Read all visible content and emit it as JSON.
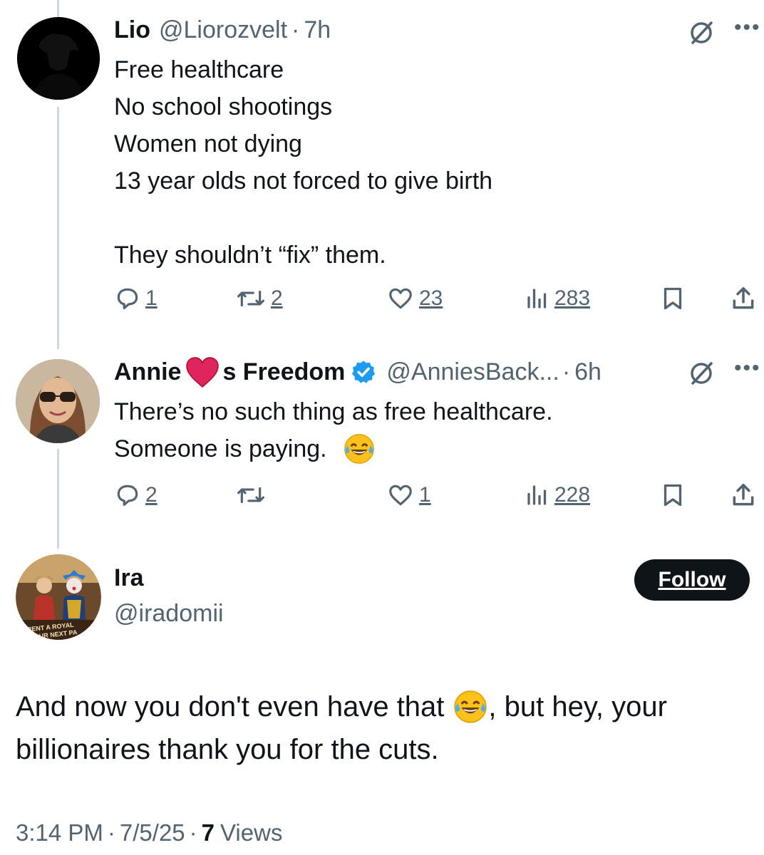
{
  "tweets": [
    {
      "author_name": "Lio",
      "author_handle": "@Liorozvelt",
      "separator": "·",
      "time": "7h",
      "lines": [
        "Free healthcare",
        "No school shootings",
        "Women not dying",
        "13 year olds not forced to give birth",
        "",
        "They shouldn’t “fix” them."
      ],
      "replies": "1",
      "reposts": "2",
      "likes": "23",
      "views": "283",
      "more_icon": "more-dots-icon"
    },
    {
      "author_name_prefix": "Annie",
      "author_name_suffix": "s Freedom",
      "author_handle": "@AnniesBack...",
      "separator": "·",
      "time": "6h",
      "verified": true,
      "lines": [
        "There’s no such thing as free healthcare.",
        "Someone is paying."
      ],
      "replies": "2",
      "reposts": "",
      "likes": "1",
      "views": "228"
    }
  ],
  "main_post": {
    "author_name": "Ira",
    "author_handle": "@iradomii",
    "follow_label": "Follow",
    "text_line1_a": "And now you don't even have that",
    "text_line1_b": ", but hey, your",
    "text_line2": "billionaires thank you for the cuts.",
    "time": "3:14 PM",
    "date": "7/5/25",
    "separator": "·",
    "views_count": "7",
    "views_label": "Views",
    "avatar_banner_text_1": "RENT A ROYAL",
    "avatar_banner_text_2": "YOUR NEXT PA"
  },
  "colors": {
    "text": "#0f1419",
    "secondary": "#536471",
    "verified": "#1d9bf0",
    "heart": "#e0245e",
    "thread_line": "#cfd9de",
    "follow_bg": "#0f1419"
  }
}
